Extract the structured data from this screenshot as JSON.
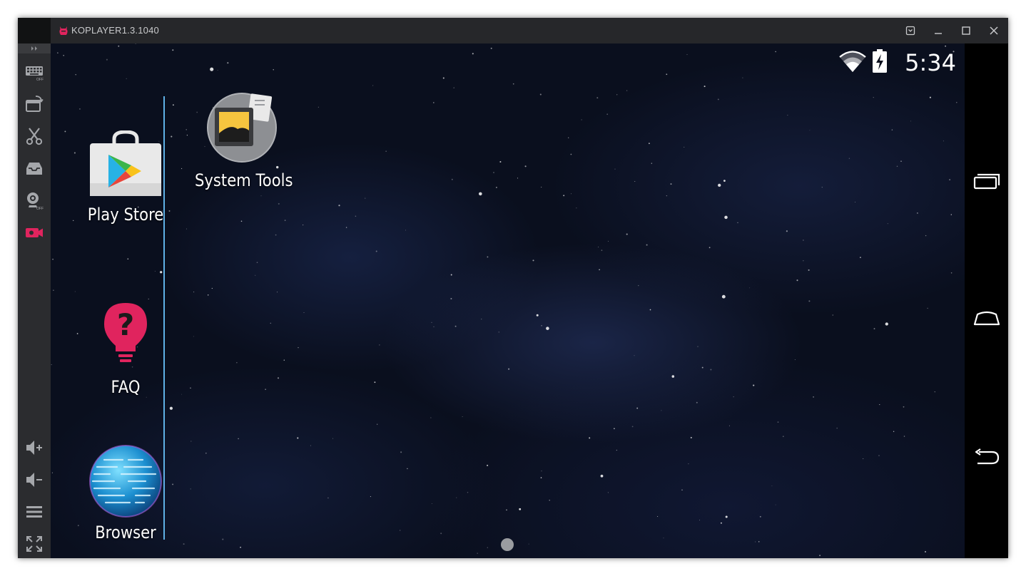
{
  "window": {
    "title": "KOPLAYER1.3.1040",
    "accent_color": "#e0245e"
  },
  "titlebar_buttons": [
    "settings-icon",
    "minimize-icon",
    "maximize-icon",
    "close-icon"
  ],
  "toolbar": {
    "items": [
      {
        "name": "keyboard-icon",
        "badge": "OFF"
      },
      {
        "name": "screen-rotate-icon"
      },
      {
        "name": "scissors-icon"
      },
      {
        "name": "inbox-icon"
      },
      {
        "name": "webcam-icon",
        "badge": "OFF"
      },
      {
        "name": "video-record-icon",
        "color": "#e0245e"
      },
      {
        "name": "volume-up-icon"
      },
      {
        "name": "volume-down-icon"
      },
      {
        "name": "menu-icon"
      },
      {
        "name": "fullscreen-icon"
      }
    ]
  },
  "statusbar": {
    "time": "5:34",
    "wifi": "full",
    "battery": "charging"
  },
  "dock": {
    "apps": [
      {
        "label": "Play Store",
        "icon": "play-store-icon"
      },
      {
        "label": "FAQ",
        "icon": "faq-icon"
      },
      {
        "label": "Browser",
        "icon": "browser-icon"
      }
    ]
  },
  "desktop": {
    "apps": [
      {
        "label": "System Tools",
        "icon": "system-tools-folder-icon"
      }
    ],
    "current_page": 1
  },
  "navbar": {
    "buttons": [
      "recent-apps-icon",
      "home-icon",
      "back-icon"
    ]
  }
}
